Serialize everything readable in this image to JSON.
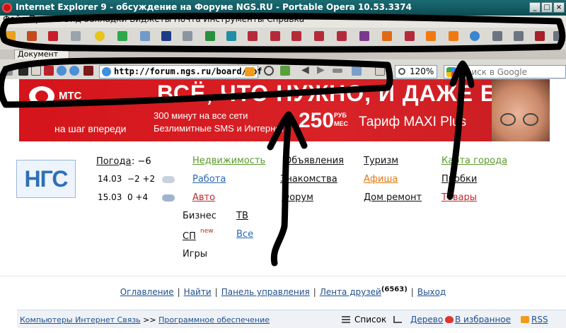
{
  "window": {
    "title": "Internet Explorer 9 - обсуждение на Форуме NGS.RU - Portable Opera 10.53.3374",
    "min": "_",
    "max": "□",
    "close": "×"
  },
  "menu": {
    "text": "Файл Правка Вид Закладки Виджеты Почта Инструменты Справка"
  },
  "tab": {
    "label": "Документ"
  },
  "address": {
    "url": "http://forum.ngs.ru/board/sof"
  },
  "zoom": {
    "value": "120%"
  },
  "search": {
    "placeholder": "Поиск в Google"
  },
  "banner": {
    "brand": "МТС",
    "headline": "ВСЁ, ЧТО НУЖНО, И ДАЖЕ БОЛЬШЕ",
    "line1": "300 минут на все сети",
    "line2": "Безлимитные SMS и Интернет",
    "tagline": "на шаг впереди",
    "price": "250",
    "price_unit_top": "РУБ",
    "price_unit_bottom": "МЕС",
    "tariff": "Тариф MAXI Plus"
  },
  "ngs": {
    "logo": "НГС",
    "weather": {
      "label": "Погода",
      "today": ": −6",
      "row1": {
        "date": "14.03",
        "temps": "−2 +2"
      },
      "row2": {
        "date": "15.03",
        "temps": "0 +4"
      }
    },
    "nav": {
      "nedvizhimost": "Недвижимость",
      "rabota": "Работа",
      "avto": "Авто",
      "biznes": "Бизнес",
      "tv": "ТВ",
      "sp": "СП",
      "sp_badge": "new",
      "vse": "Все",
      "igry": "Игры",
      "obyavleniya": "Объявления",
      "znakomstva": "Знакомства",
      "forum": "Форум",
      "turizm": "Туризм",
      "afisha": "Афиша",
      "dom_remont": "Дом ремонт",
      "karta": "Карта города",
      "probki": "Пробки",
      "tovary": "Товары"
    }
  },
  "forum": {
    "links": {
      "oglavlenie": "Оглавление",
      "nayti": "Найти",
      "panel": "Панель управления",
      "lenta": "Лента друзей",
      "lenta_count": "(6563)",
      "vyhod": "Выход",
      "sep": "|"
    },
    "breadcrumb": {
      "part1": "Компьютеры Интернет Связь",
      "sep": ">>",
      "part2": "Программное обеспечение"
    },
    "tools": {
      "spisok": "Список",
      "derevo": "Дерево",
      "izbrannoe": "В избранное",
      "rss": "RSS"
    }
  },
  "colors": {
    "title_bar": "#0c4b52",
    "banner_red": "#d4151b",
    "link_blue": "#1f4f8f",
    "ngs_green": "#5a9a2a",
    "ngs_red": "#c0282d",
    "marker": "#000000"
  }
}
